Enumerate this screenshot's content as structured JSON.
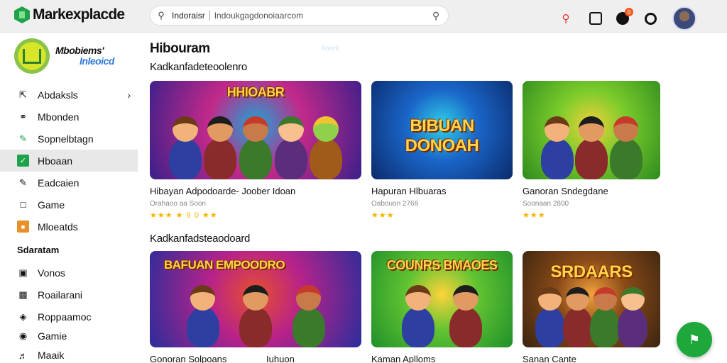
{
  "app": {
    "logo_text": "Markexplacde"
  },
  "search": {
    "prefix": "Indoraisr",
    "query": "Indoukgagdonoiaarcom"
  },
  "top_icons": {
    "notification_badge": "0"
  },
  "brand": {
    "line1": "Mbobiems'",
    "line2": "Inleoicd"
  },
  "sidebar": {
    "items": [
      {
        "label": "Abdaksls",
        "icon": "expand-icon"
      },
      {
        "label": "Mbonden",
        "icon": "compass-icon"
      },
      {
        "label": "Sopnelbtagn",
        "icon": "edit-icon"
      },
      {
        "label": "Hboaan",
        "icon": "checkbox-icon",
        "active": true
      },
      {
        "label": "Eadcaien",
        "icon": "pencil-icon"
      },
      {
        "label": "Game",
        "icon": "document-icon"
      },
      {
        "label": "Mloeatds",
        "icon": "folder-icon"
      }
    ],
    "section_label": "Sdaratam",
    "items2": [
      {
        "label": "Vonos",
        "icon": "monitor-icon"
      },
      {
        "label": "Roailarani",
        "icon": "card-icon"
      },
      {
        "label": "Roppaamoc",
        "icon": "controller-icon"
      },
      {
        "label": "Gamie",
        "icon": "gamepad-icon"
      },
      {
        "label": "Maaik",
        "icon": "music-icon"
      }
    ]
  },
  "main": {
    "page_title": "Hibouram",
    "ghost_text": "Iloanl",
    "section1_title": "Kadkanfadeteoolenro",
    "section2_title": "Kadkanfadsteaodoard",
    "cards_row1": [
      {
        "title": "Hibayan Adpodoarde-   Joober Idoan",
        "subtitle": "Orahaoo aa  Soon",
        "rating": "★★★     ★ 9 0 ★★",
        "thumb_text": "HHIOABR",
        "palette": [
          "#3a1f8a",
          "#c2298a",
          "#19a7d6"
        ]
      },
      {
        "title": "Hapuran Hlbuaras",
        "subtitle": "Oabouon 2768",
        "rating": "★★★",
        "thumb_text": "BIBUAN DONOAH",
        "palette": [
          "#0b2a6b",
          "#1a66c9",
          "#2fd1e8"
        ]
      },
      {
        "title": "Ganoran Sndegdane",
        "subtitle": "Soonaan 2800",
        "rating": "★★★",
        "thumb_text": "",
        "palette": [
          "#2e8b1f",
          "#7acb2b",
          "#f0d23a"
        ]
      }
    ],
    "cards_row2": [
      {
        "title": "Gonoran Solpoans",
        "thumb_text": "BAFUAN EMPOODRO",
        "palette": [
          "#2a2d9a",
          "#b7228a",
          "#e84f2b"
        ]
      },
      {
        "title": "Iuhuon",
        "thumb_text": "",
        "palette": [
          "#5a2ea0",
          "#9b32c4",
          "#f0892b"
        ]
      },
      {
        "title": "Kaman Aplloms",
        "thumb_text": "COUNRS BMAOES",
        "palette": [
          "#1f8f2a",
          "#62c432",
          "#ffd33a"
        ]
      },
      {
        "title": "Sanan Cante",
        "thumb_text": "SRDAARS",
        "palette": [
          "#3a2410",
          "#8a4a18",
          "#f0a23a"
        ]
      }
    ]
  },
  "fab": {
    "icon": "chat-icon"
  }
}
